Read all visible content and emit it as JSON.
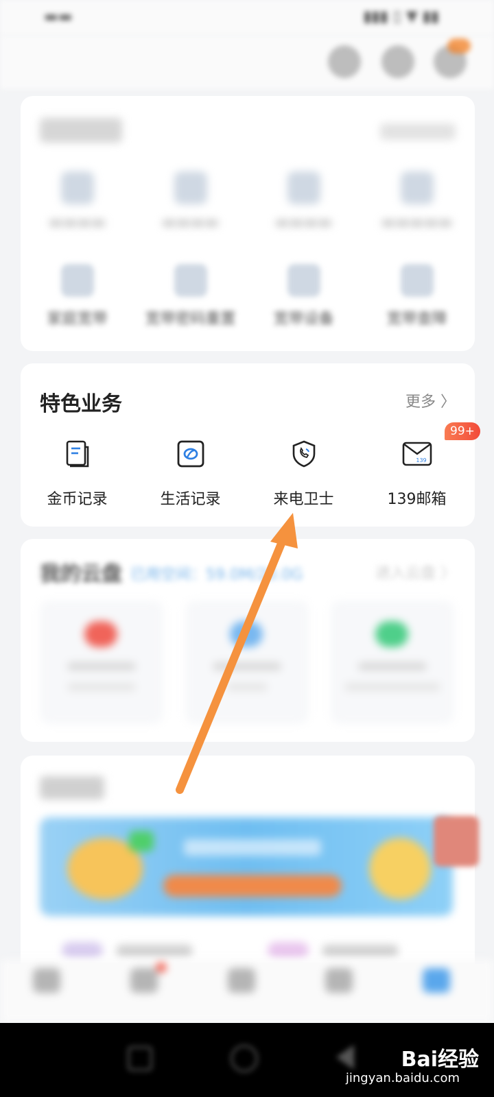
{
  "featured": {
    "title": "特色业务",
    "more": "更多 〉",
    "badge": "99+",
    "items": [
      {
        "label": "金币记录",
        "icon": "gold-record-icon"
      },
      {
        "label": "生活记录",
        "icon": "life-record-icon"
      },
      {
        "label": "来电卫士",
        "icon": "call-guard-icon"
      },
      {
        "label": "139邮箱",
        "icon": "mail-139-icon"
      }
    ],
    "mail_icon_text": "139"
  },
  "broadband": {
    "items": [
      {
        "label": "家庭宽带"
      },
      {
        "label": "宽带密码重置"
      },
      {
        "label": "宽带设备"
      },
      {
        "label": "宽带查障"
      }
    ]
  },
  "cloud": {
    "title": "我的云盘",
    "storage_text": "已用空间：59.0M/20.0G",
    "enter": "进入云盘 〉"
  },
  "colors": {
    "accent": "#4a90e2",
    "badge": "#f24b3a",
    "arrow": "#f5923e"
  },
  "watermark": {
    "brand": "Bai经验",
    "url": "jingyan.baidu.com"
  }
}
